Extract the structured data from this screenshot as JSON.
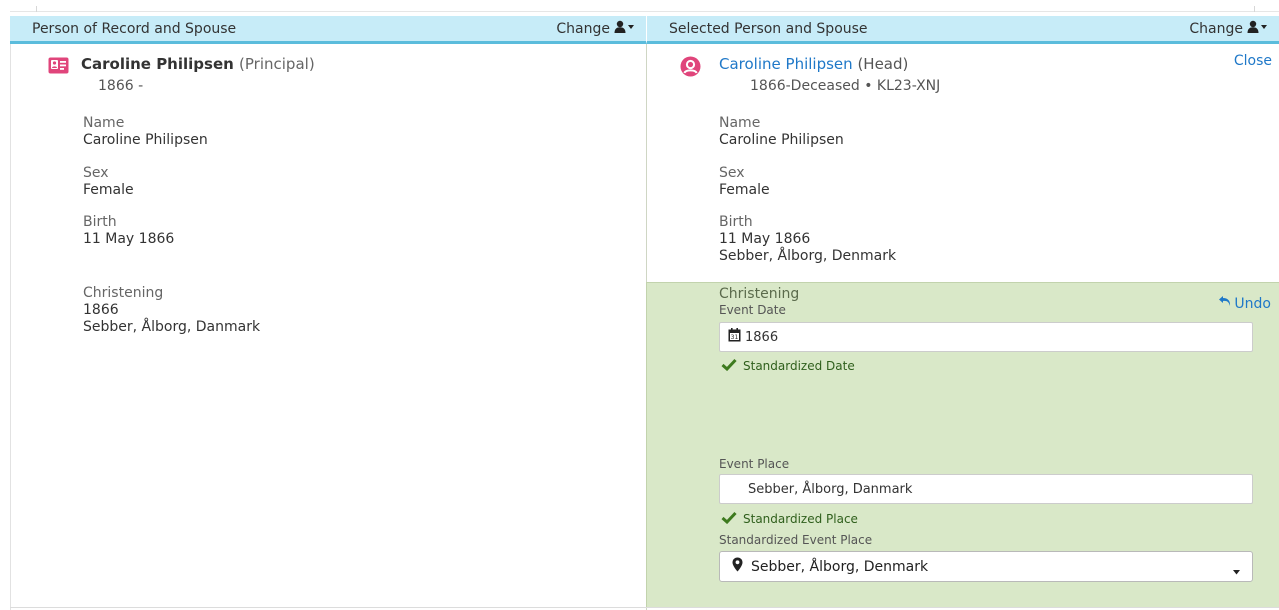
{
  "headers": {
    "left_title": "Person of Record and Spouse",
    "left_change": "Change",
    "right_title": "Selected Person and Spouse",
    "right_change": "Change"
  },
  "record_person": {
    "name": "Caroline Philipsen",
    "role": "(Principal)",
    "dates": "1866 -",
    "fields": {
      "name_label": "Name",
      "name_value": "Caroline Philipsen",
      "sex_label": "Sex",
      "sex_value": "Female",
      "birth_label": "Birth",
      "birth_date": "11 May 1866",
      "christening_label": "Christening",
      "christening_date": "1866",
      "christening_place": "Sebber, Ålborg, Danmark"
    }
  },
  "selected_person": {
    "name": "Caroline Philipsen",
    "role": "(Head)",
    "dates": "1866-Deceased • KL23-XNJ",
    "close_label": "Close",
    "fields": {
      "name_label": "Name",
      "name_value": "Caroline Philipsen",
      "sex_label": "Sex",
      "sex_value": "Female",
      "birth_label": "Birth",
      "birth_date": "11 May 1866",
      "birth_place": "Sebber, Ålborg, Denmark"
    }
  },
  "christening_edit": {
    "label": "Christening",
    "undo_label": "Undo",
    "event_date_label": "Event Date",
    "event_date_value": "1866",
    "standardized_date": "Standardized Date",
    "event_place_label": "Event Place",
    "event_place_value": "Sebber, Ålborg, Danmark",
    "standardized_place": "Standardized Place",
    "std_event_place_label": "Standardized Event Place",
    "std_event_place_value": "Sebber, Ålborg, Denmark"
  },
  "colors": {
    "header_bg": "#c7ecf8",
    "header_border": "#5bbcdc",
    "link": "#1f78c8",
    "edit_bg": "#d9e8c8",
    "record_icon": "#e0457b",
    "female_icon": "#e0457b",
    "check": "#3d7a1e"
  },
  "icons": {
    "change": "person-dropdown-icon",
    "record": "record-card-icon",
    "selected": "female-person-icon",
    "undo": "undo-arrow-icon",
    "calendar": "calendar-icon",
    "check": "checkmark-icon",
    "place": "map-pin-icon",
    "caret": "caret-down-icon"
  }
}
